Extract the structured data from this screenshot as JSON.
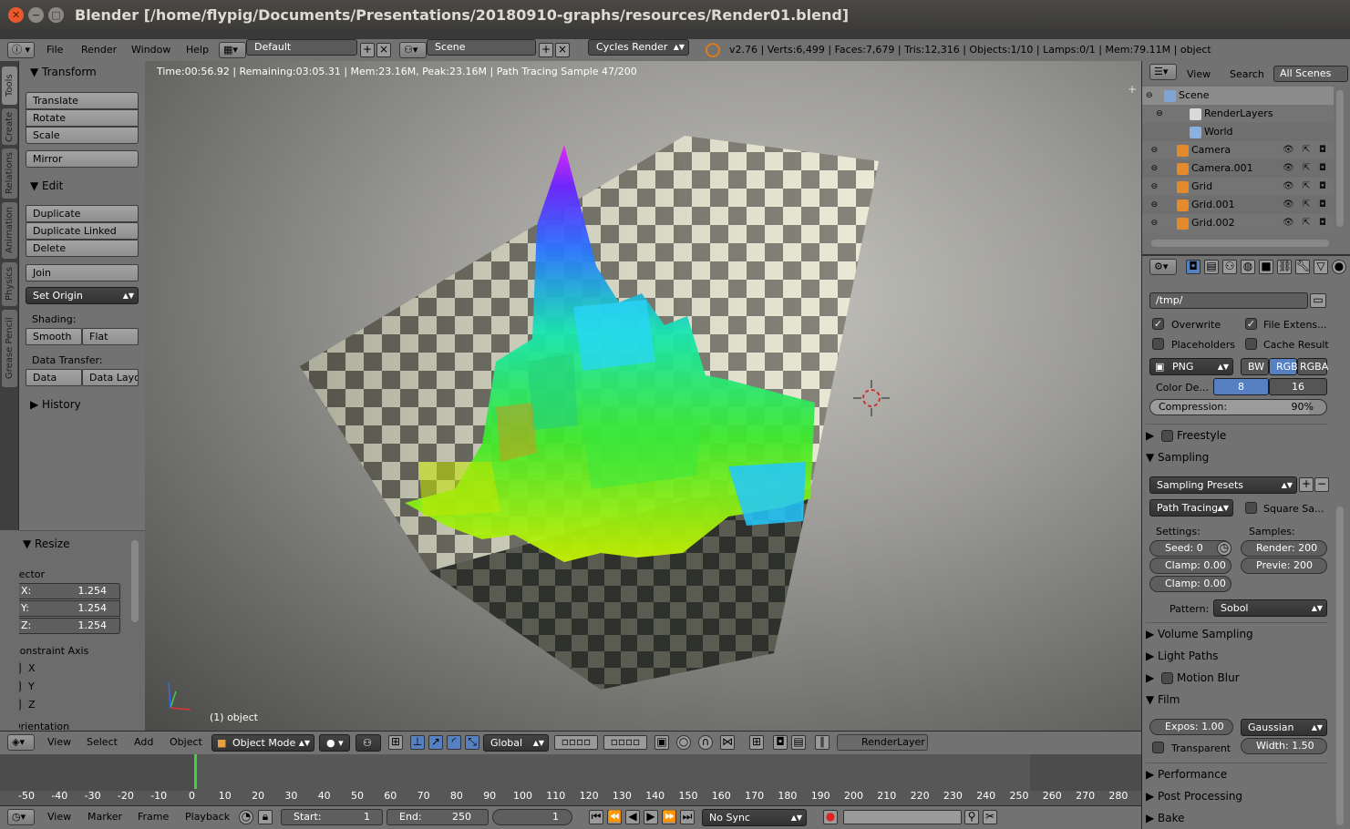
{
  "window": {
    "title": "Blender [/home/flypig/Documents/Presentations/20180910-graphs/resources/Render01.blend]"
  },
  "info_header": {
    "menus": [
      "File",
      "Render",
      "Window",
      "Help"
    ],
    "layout": "Default",
    "scene": "Scene",
    "engine": "Cycles Render",
    "stats": "v2.76 | Verts:6,499 | Faces:7,679 | Tris:12,316 | Objects:1/10 | Lamps:0/1 | Mem:79.11M | object"
  },
  "tool_tabs": [
    "Tools",
    "Create",
    "Relations",
    "Animation",
    "Physics",
    "Grease Pencil"
  ],
  "toolshelf": {
    "transform_title": "Transform",
    "transform_buttons": [
      "Translate",
      "Rotate",
      "Scale",
      "Mirror"
    ],
    "edit_title": "Edit",
    "edit_buttons": [
      "Duplicate",
      "Duplicate Linked",
      "Delete",
      "Join"
    ],
    "set_origin": "Set Origin",
    "shading_label": "Shading:",
    "smooth": "Smooth",
    "flat": "Flat",
    "data_transfer_label": "Data Transfer:",
    "data": "Data",
    "data_layo": "Data Layo",
    "history_title": "History"
  },
  "operator": {
    "title": "Resize",
    "vector_label": "Vector",
    "x_label": "X:",
    "x_value": "1.254",
    "y_label": "Y:",
    "y_value": "1.254",
    "z_label": "Z:",
    "z_value": "1.254",
    "constraint_label": "Constraint Axis",
    "axis_x": "X",
    "axis_y": "Y",
    "axis_z": "Z",
    "orientation_label": "Orientation"
  },
  "viewport": {
    "render_status": "Time:00:56.92 | Remaining:03:05.31 | Mem:23.16M, Peak:23.16M | Path Tracing Sample 47/200",
    "object_label": "(1) object"
  },
  "viewport_header": {
    "menus": [
      "View",
      "Select",
      "Add",
      "Object"
    ],
    "mode": "Object Mode",
    "orientation": "Global",
    "render_layer": "RenderLayer"
  },
  "timeline": {
    "ticks": [
      "-50",
      "-40",
      "-30",
      "-20",
      "-10",
      "0",
      "10",
      "20",
      "30",
      "40",
      "50",
      "60",
      "70",
      "80",
      "90",
      "100",
      "110",
      "120",
      "130",
      "140",
      "150",
      "160",
      "170",
      "180",
      "190",
      "200",
      "210",
      "220",
      "230",
      "240",
      "250",
      "260",
      "270",
      "280"
    ],
    "current_frame_indicator": 0,
    "footer_menus": [
      "View",
      "Marker",
      "Frame",
      "Playback"
    ],
    "start_label": "Start:",
    "start_value": "1",
    "end_label": "End:",
    "end_value": "250",
    "current_frame": "1",
    "sync": "No Sync"
  },
  "outliner": {
    "menus": [
      "View",
      "Search"
    ],
    "filter": "All Scenes",
    "items": [
      {
        "name": "Scene",
        "icon": "scene-icon"
      },
      {
        "name": "RenderLayers",
        "icon": "renderlayers-icon"
      },
      {
        "name": "World",
        "icon": "world-icon"
      },
      {
        "name": "Camera",
        "icon": "camera-icon"
      },
      {
        "name": "Camera.001",
        "icon": "camera-icon"
      },
      {
        "name": "Grid",
        "icon": "mesh-icon"
      },
      {
        "name": "Grid.001",
        "icon": "mesh-icon"
      },
      {
        "name": "Grid.002",
        "icon": "mesh-icon"
      }
    ]
  },
  "properties": {
    "output_path": "/tmp/",
    "overwrite": "Overwrite",
    "file_extensions": "File Extens...",
    "placeholders": "Placeholders",
    "cache_result": "Cache Result",
    "format": "PNG",
    "bw": "BW",
    "rgb": "RGB",
    "rgba": "RGBA",
    "color_depth_label": "Color De...",
    "depth_8": "8",
    "depth_16": "16",
    "compression_label": "Compression:",
    "compression_value": "90%",
    "compression_fraction": 0.9,
    "freestyle": "Freestyle",
    "sampling": "Sampling",
    "sampling_presets": "Sampling Presets",
    "path_tracing": "Path Tracing",
    "square_samples": "Square Sa...",
    "settings_label": "Settings:",
    "samples_label": "Samples:",
    "seed": "Seed:   0",
    "render_samples": "Render: 200",
    "clamp1": "Clamp: 0.00",
    "preview_samples": "Previe:   200",
    "clamp2": "Clamp: 0.00",
    "pattern_label": "Pattern:",
    "pattern": "Sobol",
    "volume_sampling": "Volume Sampling",
    "light_paths": "Light Paths",
    "motion_blur": "Motion Blur",
    "film": "Film",
    "exposure": "Expos:  1.00",
    "filter": "Gaussian",
    "transparent": "Transparent",
    "width": "Width:  1.50",
    "performance": "Performance",
    "post_processing": "Post Processing",
    "bake": "Bake"
  },
  "colors": {
    "accent_blue": "#5680c2",
    "ubuntu_close": "#e9592b",
    "panel_bg": "#727272"
  }
}
